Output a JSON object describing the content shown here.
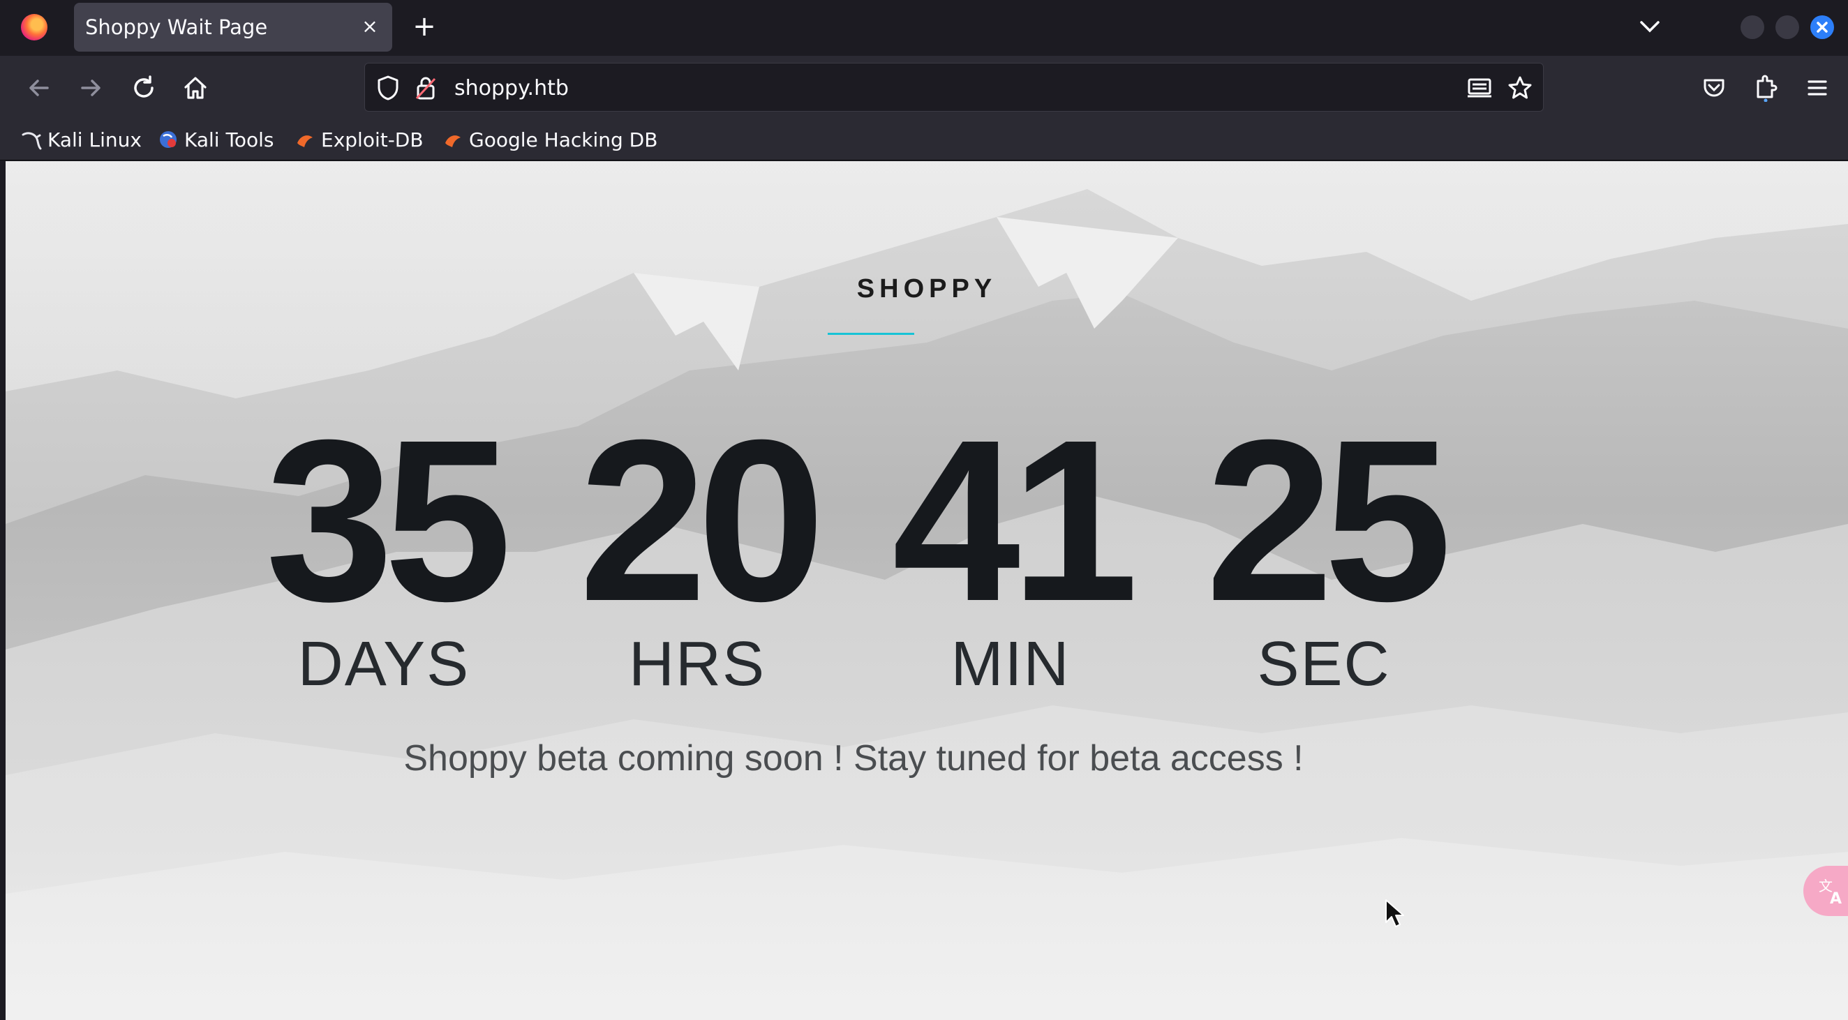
{
  "browser": {
    "tab_title": "Shoppy Wait Page",
    "tab_close": "×",
    "new_tab": "+",
    "url": "shoppy.htb"
  },
  "bookmarks": [
    {
      "label": "Kali Linux",
      "icon": "kali-dragon-icon"
    },
    {
      "label": "Kali Tools",
      "icon": "kali-tools-icon"
    },
    {
      "label": "Exploit-DB",
      "icon": "exploit-db-icon"
    },
    {
      "label": "Google Hacking DB",
      "icon": "ghdb-icon"
    }
  ],
  "page": {
    "brand": "SHOPPY",
    "countdown": [
      {
        "value": "35",
        "label": "DAYS"
      },
      {
        "value": "20",
        "label": "HRS"
      },
      {
        "value": "41",
        "label": "MIN"
      },
      {
        "value": "25",
        "label": "SEC"
      }
    ],
    "tagline": "Shoppy beta coming soon ! Stay tuned for beta access !"
  },
  "colors": {
    "accent_line": "#17c3d6",
    "chrome_dark": "#1c1b22",
    "toolbar": "#2b2a33"
  }
}
